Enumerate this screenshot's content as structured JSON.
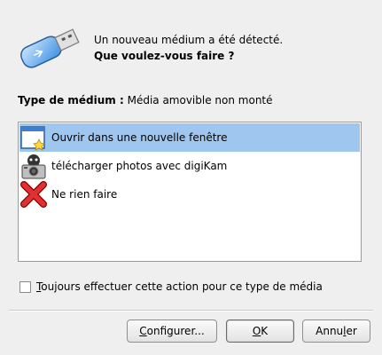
{
  "dialog": {
    "message_line1": "Un nouveau médium a été détecté.",
    "message_line2": "Que voulez-vous faire ?",
    "type_label": "Type de médium :",
    "type_value": "Média amovible non monté"
  },
  "actions": [
    {
      "label": "Ouvrir dans une nouvelle fenêtre",
      "icon": "new-window-icon",
      "selected": true
    },
    {
      "label": "télécharger photos avec digiKam",
      "icon": "camera-icon",
      "selected": false
    },
    {
      "label": "Ne rien faire",
      "icon": "red-x-icon",
      "selected": false
    }
  ],
  "checkbox": {
    "label_first": "T",
    "label_rest": "oujours effectuer cette action pour ce type de média",
    "checked": false
  },
  "buttons": {
    "configure_first": "C",
    "configure_rest": "onfigurer...",
    "ok_first": "O",
    "ok_rest": "K",
    "cancel_pre": "Annu",
    "cancel_mn": "l",
    "cancel_post": "er"
  },
  "colors": {
    "selection": "#9fc6ef",
    "background": "#efefef"
  }
}
